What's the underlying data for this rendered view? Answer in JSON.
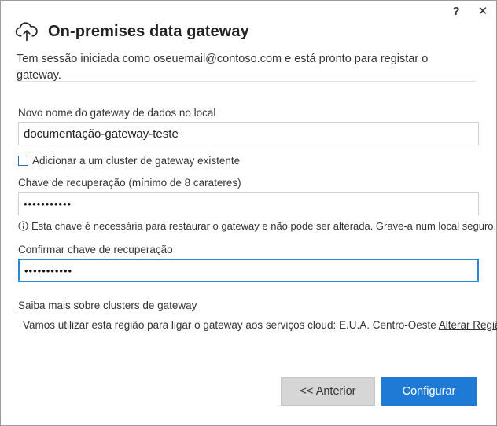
{
  "titlebar": {
    "help_label": "?",
    "close_label": "✕"
  },
  "header": {
    "title": "On-premises data gateway",
    "icon": "cloud-upload-icon"
  },
  "signin": {
    "text": "Tem sessão iniciada como oseuemail@contoso.com e está pronto para registar o gateway."
  },
  "form": {
    "gateway_name_label": "Novo nome do gateway de dados no local",
    "gateway_name_value": "documentação-gateway-teste",
    "cluster_checkbox_label": "Adicionar a um cluster de gateway existente",
    "cluster_checked": false,
    "recovery_key_label": "Chave de recuperação (mínimo de 8 carateres)",
    "recovery_key_value": "•••••••••••",
    "info_text": "Esta chave é necessária para restaurar o gateway e não pode ser alterada. Grave-a num local seguro.",
    "confirm_key_label": "Confirmar chave de recuperação",
    "confirm_key_value": "•••••••••••"
  },
  "footer": {
    "learn_more_link": "Saiba mais sobre clusters de gateway",
    "region_text": "Vamos utilizar esta região para ligar o gateway aos serviços cloud: E.U.A. Centro-Oeste",
    "change_region_link": "Alterar Região"
  },
  "buttons": {
    "back_label": "<< Anterior",
    "configure_label": "Configurar"
  },
  "colors": {
    "accent": "#1f7ad6",
    "focus_border": "#2b87d8",
    "secondary_button": "#d6d6d6"
  }
}
